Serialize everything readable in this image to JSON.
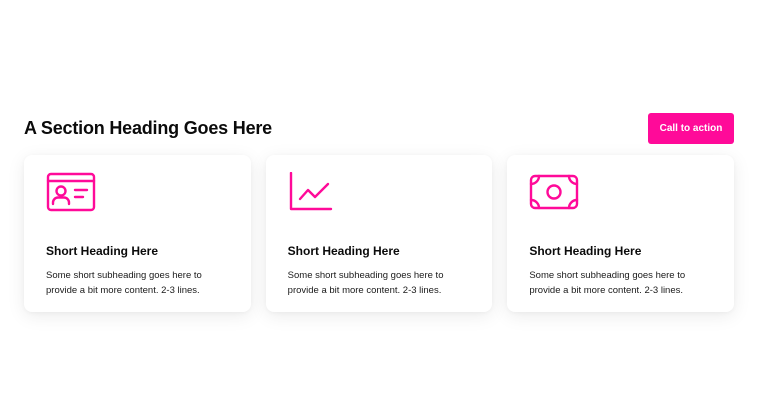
{
  "section": {
    "title": "A Section Heading Goes Here",
    "cta_label": "Call to action"
  },
  "colors": {
    "accent": "#ff0a99",
    "background": "#ffffff",
    "text": "#111111"
  },
  "cards": [
    {
      "icon": "id-card-icon",
      "heading": "Short Heading Here",
      "text": "Some short subheading goes here to provide a bit more content. 2-3 lines."
    },
    {
      "icon": "line-chart-icon",
      "heading": "Short Heading Here",
      "text": "Some short subheading goes here to provide a bit more content. 2-3 lines."
    },
    {
      "icon": "money-bill-icon",
      "heading": "Short Heading Here",
      "text": "Some short subheading goes here to provide a bit more content. 2-3 lines."
    }
  ]
}
